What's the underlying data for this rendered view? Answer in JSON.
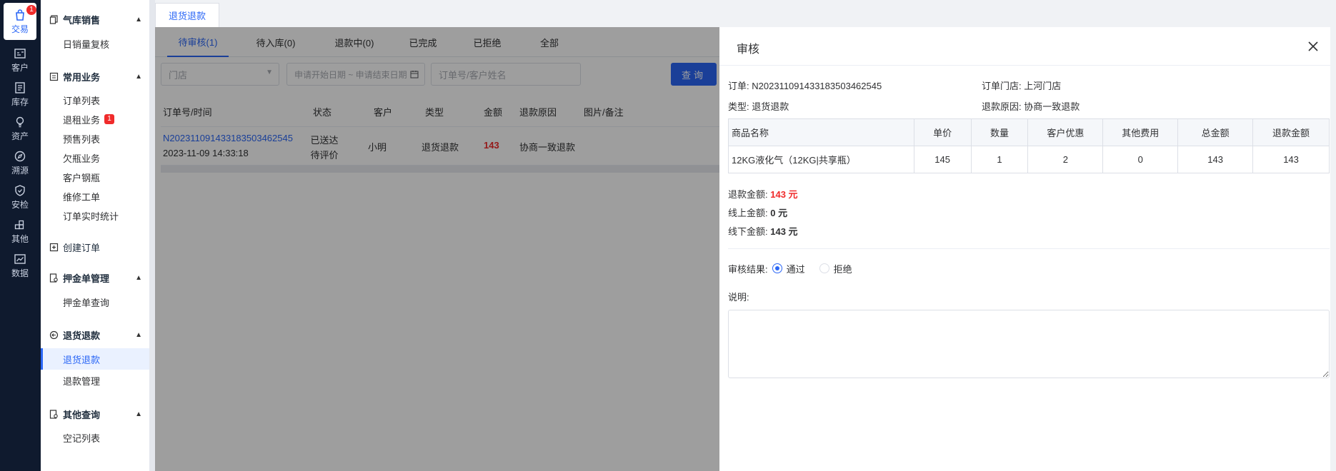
{
  "rail": {
    "items": [
      {
        "label": "交易",
        "icon": "bag-icon",
        "badge": "1",
        "active": true
      },
      {
        "label": "客户",
        "icon": "id-card-icon"
      },
      {
        "label": "库存",
        "icon": "inventory-icon"
      },
      {
        "label": "资产",
        "icon": "bulb-icon"
      },
      {
        "label": "溯源",
        "icon": "compass-icon"
      },
      {
        "label": "安检",
        "icon": "shield-icon"
      },
      {
        "label": "其他",
        "icon": "grid-icon"
      },
      {
        "label": "数据",
        "icon": "chart-icon"
      }
    ]
  },
  "menu": {
    "groups": [
      {
        "label": "气库销售",
        "items": [
          "日销量复核"
        ]
      },
      {
        "label": "常用业务",
        "items": [
          "订单列表",
          "退租业务",
          "预售列表",
          "欠瓶业务",
          "客户钢瓶",
          "维修工单",
          "订单实时统计"
        ],
        "badge_item": "退租业务",
        "badge": "1"
      },
      {
        "label": "创建订单",
        "items": []
      },
      {
        "label": "押金单管理",
        "items": [
          "押金单查询"
        ]
      },
      {
        "label": "退货退款",
        "items": [
          "退货退款",
          "退款管理"
        ],
        "active_item": "退货退款"
      },
      {
        "label": "其他查询",
        "items": [
          "空记列表"
        ]
      }
    ]
  },
  "top_tab": "退货退款",
  "subtabs": [
    "待审核(1)",
    "待入库(0)",
    "退款中(0)",
    "已完成",
    "已拒绝",
    "全部"
  ],
  "filters": {
    "store_placeholder": "门店",
    "date_placeholder": "申请开始日期 ~ 申请结束日期",
    "keyword_placeholder": "订单号/客户姓名",
    "search_label": "查询"
  },
  "table": {
    "columns": [
      "订单号/时间",
      "状态",
      "客户",
      "类型",
      "金额",
      "退款原因",
      "图片/备注"
    ],
    "rows": [
      {
        "order_no": "N20231109143318350346254​5",
        "time": "2023-11-09 14:33:18",
        "status1": "已送达",
        "status2": "待评价",
        "customer": "小明",
        "type": "退货退款",
        "amount": "143",
        "reason": "协商一致退款"
      }
    ]
  },
  "drawer": {
    "title": "审核",
    "order_label": "订单:",
    "order_no": "N20231109143318350346254​5",
    "store_label": "订单门店:",
    "store": "上河门店",
    "type_label": "类型:",
    "type": "退货退款",
    "reason_label": "退款原因:",
    "reason": "协商一致退款",
    "goods_columns": [
      "商品名称",
      "单价",
      "数量",
      "客户优惠",
      "其他费用",
      "总金额",
      "退款金额"
    ],
    "goods_rows": [
      [
        "12KG液化气（12KG|共享瓶）",
        "145",
        "1",
        "2",
        "0",
        "143",
        "143"
      ]
    ],
    "refund_label": "退款金额:",
    "refund_value": "143 元",
    "online_label": "线上金额:",
    "online_value": "0 元",
    "offline_label": "线下金额:",
    "offline_value": "143 元",
    "result_label": "审核结果:",
    "approve_label": "通过",
    "reject_label": "拒绝",
    "desc_label": "说明:"
  },
  "colors": {
    "accent": "#2b67f6",
    "danger": "#f02b2b",
    "rail_bg": "#0f1a2e"
  }
}
